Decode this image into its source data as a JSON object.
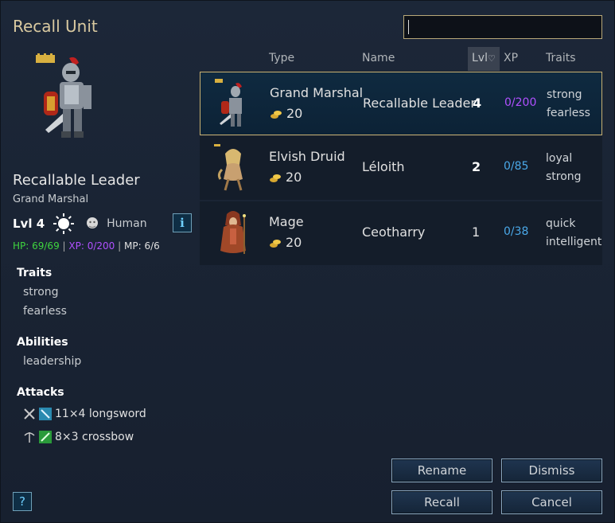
{
  "window": {
    "title": "Recall Unit"
  },
  "search": {
    "value": "",
    "placeholder": ""
  },
  "details": {
    "name": "Recallable Leader",
    "type": "Grand Marshal",
    "level": "Lvl 4",
    "race": "Human",
    "hp": "HP: 69/69",
    "xp": "XP: 0/200",
    "mp": "MP: 6/6",
    "sep": "|",
    "info_label": "i",
    "traits_heading": "Traits",
    "traits": [
      "strong",
      "fearless"
    ],
    "abilities_heading": "Abilities",
    "abilities": [
      "leadership"
    ],
    "attacks_heading": "Attacks",
    "attacks": [
      {
        "text": "11×4 longsword",
        "icon": "sword-icon",
        "type_icon": "blade-icon"
      },
      {
        "text": "8×3 crossbow",
        "icon": "crossbow-icon",
        "type_icon": "pierce-icon"
      }
    ]
  },
  "table": {
    "columns": {
      "type": "Type",
      "name": "Name",
      "lvl": "Lvl",
      "lvl_sort": "♡",
      "xp": "XP",
      "traits": "Traits"
    },
    "rows": [
      {
        "type": "Grand Marshal",
        "cost": "20",
        "name": "Recallable Leader",
        "level": "4",
        "xp": "0/200",
        "traits": [
          "strong",
          "fearless"
        ],
        "xp_color": "#b050ff",
        "selected": true
      },
      {
        "type": "Elvish Druid",
        "cost": "20",
        "name": "Léloith",
        "level": "2",
        "xp": "0/85",
        "traits": [
          "loyal",
          "strong"
        ],
        "xp_color": "#4aa8e8",
        "selected": false
      },
      {
        "type": "Mage",
        "cost": "20",
        "name": "Ceotharry",
        "level": "1",
        "xp": "0/38",
        "traits": [
          "quick",
          "intelligent"
        ],
        "xp_color": "#4aa8e8",
        "selected": false
      }
    ]
  },
  "buttons": {
    "rename": "Rename",
    "dismiss": "Dismiss",
    "recall": "Recall",
    "cancel": "Cancel",
    "help": "?"
  },
  "colors": {
    "accent": "#c8b070",
    "hp": "#3fd43f",
    "xp": "#b050ff",
    "xp_low": "#4aa8e8",
    "title": "#d9c9a0"
  }
}
